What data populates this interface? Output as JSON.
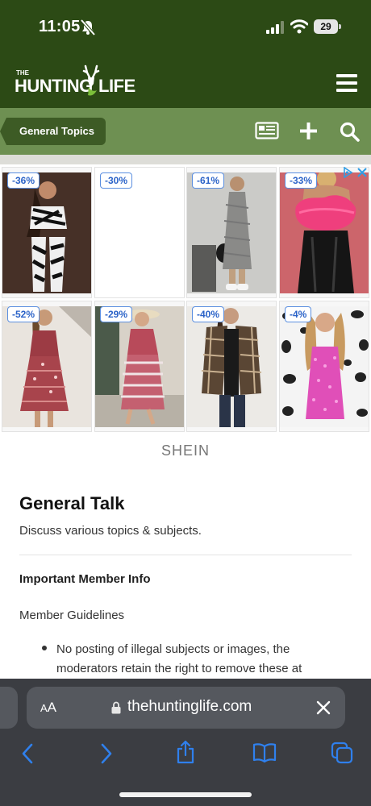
{
  "status_bar": {
    "time": "11:05",
    "battery": "29"
  },
  "header": {
    "logo_small": "THE",
    "logo_main": "HUNTING",
    "logo_life": "LIFE"
  },
  "subnav": {
    "breadcrumb": "General Topics"
  },
  "ad": {
    "brand": "SHEIN",
    "items": [
      {
        "discount": "-36%"
      },
      {
        "discount": "-30%"
      },
      {
        "discount": "-61%"
      },
      {
        "discount": "-33%"
      },
      {
        "discount": "-52%"
      },
      {
        "discount": "-29%"
      },
      {
        "discount": "-40%"
      },
      {
        "discount": "-4%"
      }
    ]
  },
  "forum": {
    "title": "General Talk",
    "description": "Discuss various topics & subjects.",
    "info_heading": "Important Member Info",
    "guidelines": "Member Guidelines",
    "bullet": "No posting of illegal subjects or images, the moderators retain the right to remove these at"
  },
  "browser": {
    "text_size_big": "A",
    "text_size_small": "A",
    "url": "thehuntinglife.com"
  },
  "colors": {
    "header_green": "#2c4a15",
    "subnav_green": "#6e9052",
    "breadcrumb_green": "#3d5b25",
    "browser_bg": "#3b3d42",
    "link_blue": "#2f80ed"
  }
}
